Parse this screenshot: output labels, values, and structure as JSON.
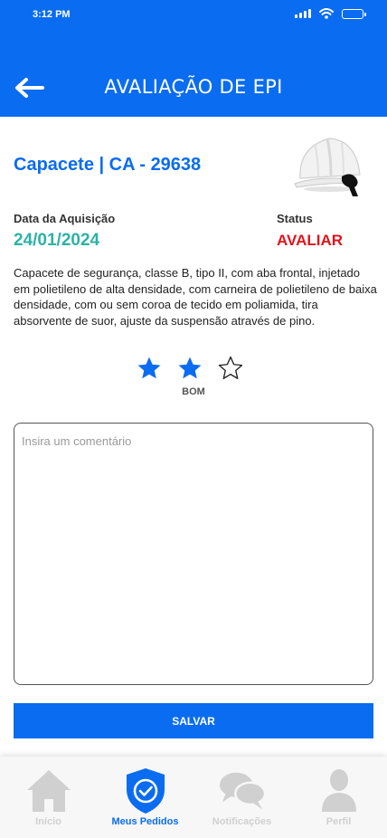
{
  "status_bar": {
    "time": "3:12 PM"
  },
  "header": {
    "title": "AVALIAÇÃO DE EPI"
  },
  "product": {
    "title": "Capacete | CA - 29638",
    "acquisition_label": "Data da Aquisição",
    "acquisition_date": "24/01/2024",
    "status_label": "Status",
    "status_value": "AVALIAR",
    "description": "Capacete de segurança, classe B, tipo II, com aba frontal, injetado em polietileno de alta densidade, com carneira de polietileno de baixa densidade, com ou sem coroa de tecido em poliamida, tira absorvente de suor, ajuste da suspensão através de pino."
  },
  "rating": {
    "value": 2,
    "max": 3,
    "label": "BOM"
  },
  "comment": {
    "placeholder": "Insira um comentário",
    "value": ""
  },
  "save_label": "SALVAR",
  "nav": {
    "items": [
      {
        "label": "Início",
        "icon": "home-icon",
        "active": false
      },
      {
        "label": "Meus Pedidos",
        "icon": "shield-check-icon",
        "active": true
      },
      {
        "label": "Notificações",
        "icon": "chat-bubbles-icon",
        "active": false
      },
      {
        "label": "Perfil",
        "icon": "user-icon",
        "active": false
      }
    ]
  },
  "colors": {
    "primary": "#0a6cf0",
    "date": "#2bb3a6",
    "status_alert": "#e0141c",
    "nav_inactive": "#d0d0d0"
  }
}
